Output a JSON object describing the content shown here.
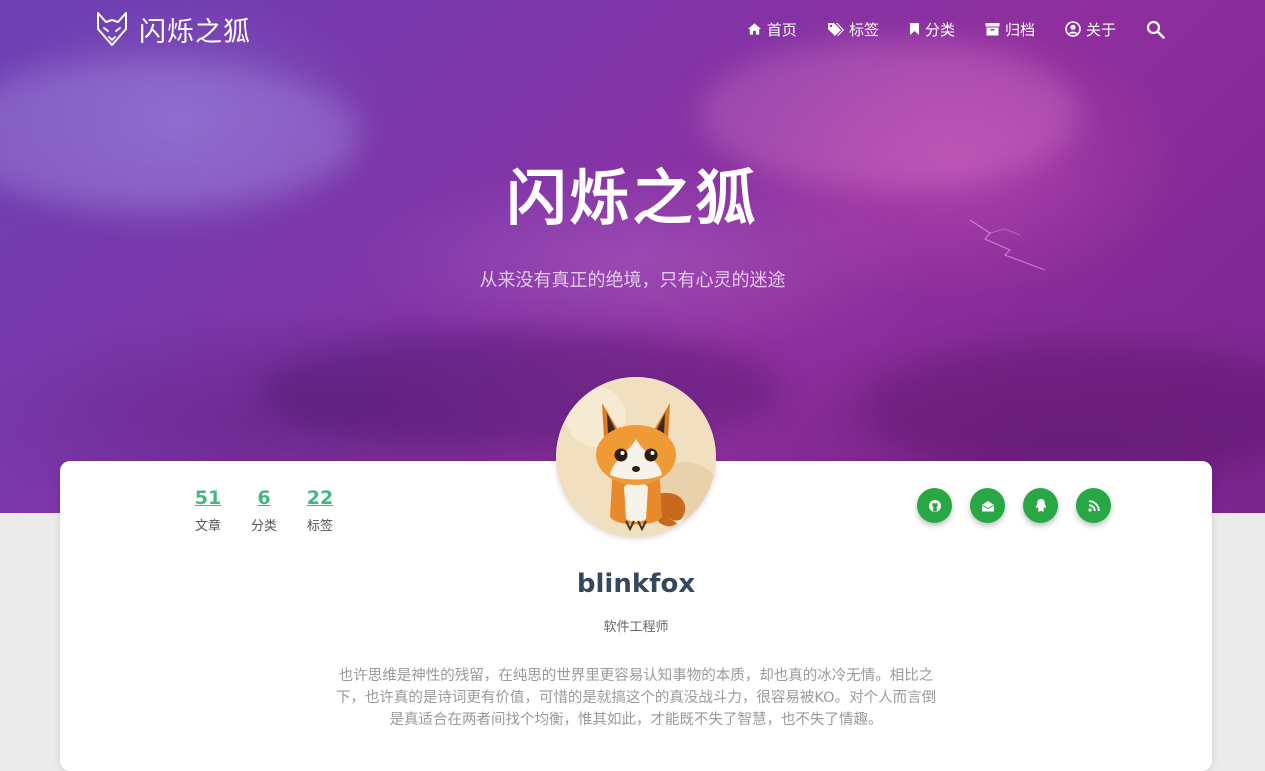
{
  "site": {
    "title": "闪烁之狐",
    "logo_icon": "fox-logo-icon"
  },
  "nav": {
    "items": [
      {
        "label": "首页",
        "icon": "home-icon"
      },
      {
        "label": "标签",
        "icon": "tags-icon"
      },
      {
        "label": "分类",
        "icon": "bookmark-icon"
      },
      {
        "label": "归档",
        "icon": "archive-icon"
      },
      {
        "label": "关于",
        "icon": "user-circle-icon"
      }
    ],
    "search_icon": "search-icon"
  },
  "hero": {
    "title": "闪烁之狐",
    "subtitle": "从来没有真正的绝境，只有心灵的迷途"
  },
  "profile": {
    "avatar": "fox-avatar",
    "name": "blinkfox",
    "career": "软件工程师",
    "bio": "也许思维是神性的残留，在纯思的世界里更容易认知事物的本质，却也真的冰冷无情。相比之下，也许真的是诗词更有价值，可惜的是就搞这个的真没战斗力，很容易被KO。对个人而言倒是真适合在两者间找个均衡，惟其如此，才能既不失了智慧，也不失了情趣。",
    "stats": [
      {
        "value": "51",
        "label": "文章"
      },
      {
        "value": "6",
        "label": "分类"
      },
      {
        "value": "22",
        "label": "标签"
      }
    ],
    "socials": [
      {
        "icon": "github-icon"
      },
      {
        "icon": "email-icon"
      },
      {
        "icon": "qq-icon"
      },
      {
        "icon": "rss-icon"
      }
    ]
  },
  "colors": {
    "accent": "#42b983",
    "social_green": "#27a844",
    "heading": "#34495e"
  }
}
